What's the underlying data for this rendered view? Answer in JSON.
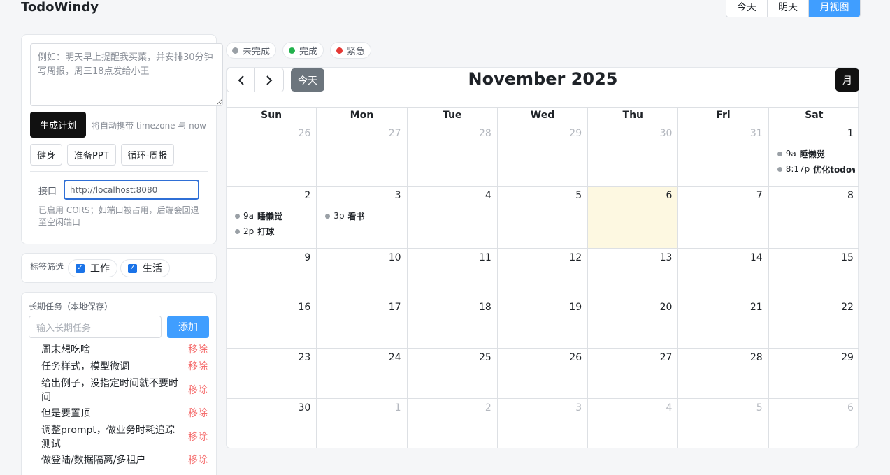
{
  "app": {
    "title": "TodoWindy"
  },
  "views": [
    {
      "label": "今天",
      "active": false
    },
    {
      "label": "明天",
      "active": false
    },
    {
      "label": "月视图",
      "active": true
    }
  ],
  "plan": {
    "placeholder": "例如：明天早上提醒我买菜，并安排30分钟写周报，周三18点发给小王",
    "generate_label": "生成计划",
    "generate_hint": "将自动携带 timezone 与 now",
    "quick": [
      "健身",
      "准备PPT",
      "循环-周报"
    ],
    "api_label": "接口",
    "api_value": "http://localhost:8080",
    "api_note": "已启用 CORS；如端口被占用，后端会回退至空闲端口"
  },
  "tags": {
    "label": "标签筛选",
    "items": [
      {
        "label": "工作",
        "checked": true
      },
      {
        "label": "生活",
        "checked": true
      }
    ]
  },
  "long_tasks": {
    "title": "长期任务（本地保存）",
    "placeholder": "输入长期任务",
    "add_label": "添加",
    "remove_label": "移除",
    "items": [
      "周末想吃啥",
      "任务样式，模型微调",
      "给出例子，没指定时间就不要时间",
      "但是要置顶",
      "调整prompt，做业务时耗追踪测试",
      "做登陆/数据隔离/多租户"
    ]
  },
  "legend": [
    {
      "label": "未完成",
      "color": "#9aa0a6"
    },
    {
      "label": "完成",
      "color": "#22b14c"
    },
    {
      "label": "紧急",
      "color": "#e53935"
    }
  ],
  "calendar": {
    "title": "November 2025",
    "today_label": "今天",
    "month_label": "月",
    "weekdays": [
      "Sun",
      "Mon",
      "Tue",
      "Wed",
      "Thu",
      "Fri",
      "Sat"
    ],
    "weeks": [
      [
        {
          "d": "26",
          "other": true
        },
        {
          "d": "27",
          "other": true
        },
        {
          "d": "28",
          "other": true
        },
        {
          "d": "29",
          "other": true
        },
        {
          "d": "30",
          "other": true
        },
        {
          "d": "31",
          "other": true
        },
        {
          "d": "1",
          "events": [
            {
              "time": "9a",
              "title": "睡懒觉"
            },
            {
              "time": "8:17p",
              "title": "优化todowindy"
            }
          ]
        }
      ],
      [
        {
          "d": "2",
          "events": [
            {
              "time": "9a",
              "title": "睡懒觉"
            },
            {
              "time": "2p",
              "title": "打球"
            }
          ]
        },
        {
          "d": "3",
          "events": [
            {
              "time": "3p",
              "title": "看书"
            }
          ]
        },
        {
          "d": "4"
        },
        {
          "d": "5"
        },
        {
          "d": "6",
          "today": true
        },
        {
          "d": "7"
        },
        {
          "d": "8"
        }
      ],
      [
        {
          "d": "9"
        },
        {
          "d": "10"
        },
        {
          "d": "11"
        },
        {
          "d": "12"
        },
        {
          "d": "13"
        },
        {
          "d": "14"
        },
        {
          "d": "15"
        }
      ],
      [
        {
          "d": "16"
        },
        {
          "d": "17"
        },
        {
          "d": "18"
        },
        {
          "d": "19"
        },
        {
          "d": "20"
        },
        {
          "d": "21"
        },
        {
          "d": "22"
        }
      ],
      [
        {
          "d": "23"
        },
        {
          "d": "24"
        },
        {
          "d": "25"
        },
        {
          "d": "26"
        },
        {
          "d": "27"
        },
        {
          "d": "28"
        },
        {
          "d": "29"
        }
      ],
      [
        {
          "d": "30"
        },
        {
          "d": "1",
          "other": true
        },
        {
          "d": "2",
          "other": true
        },
        {
          "d": "3",
          "other": true
        },
        {
          "d": "4",
          "other": true
        },
        {
          "d": "5",
          "other": true
        },
        {
          "d": "6",
          "other": true
        }
      ]
    ]
  }
}
